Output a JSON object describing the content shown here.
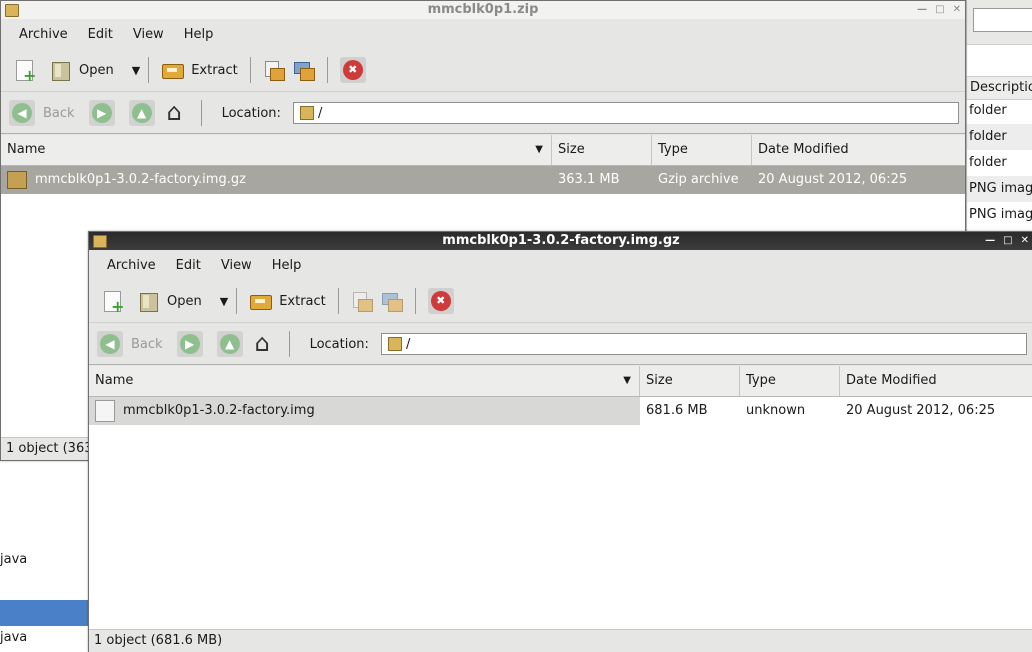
{
  "background": {
    "right_col_header": "Descriptio",
    "right_rows": [
      "folder",
      "folder",
      "folder",
      "PNG image",
      "PNG image"
    ],
    "left_rows": [
      "java",
      "java"
    ]
  },
  "win1": {
    "title": "mmcblk0p1.zip",
    "menu": [
      "Archive",
      "Edit",
      "View",
      "Help"
    ],
    "toolbar": {
      "open_label": "Open",
      "extract_label": "Extract"
    },
    "nav": {
      "back_label": "Back",
      "location_label": "Location:",
      "location_value": "/"
    },
    "columns": [
      "Name",
      "Size",
      "Type",
      "Date Modified"
    ],
    "rows": [
      {
        "name": "mmcblk0p1-3.0.2-factory.img.gz",
        "size": "363.1 MB",
        "type": "Gzip archive",
        "date": "20 August 2012, 06:25"
      }
    ],
    "status": "1 object (363"
  },
  "win2": {
    "title": "mmcblk0p1-3.0.2-factory.img.gz",
    "menu": [
      "Archive",
      "Edit",
      "View",
      "Help"
    ],
    "toolbar": {
      "open_label": "Open",
      "extract_label": "Extract"
    },
    "nav": {
      "back_label": "Back",
      "location_label": "Location:",
      "location_value": "/"
    },
    "columns": [
      "Name",
      "Size",
      "Type",
      "Date Modified"
    ],
    "rows": [
      {
        "name": "mmcblk0p1-3.0.2-factory.img",
        "size": "681.6 MB",
        "type": "unknown",
        "date": "20 August 2012, 06:25"
      }
    ],
    "status": "1 object (681.6 MB)"
  },
  "colors": {
    "selection_dark": "#a7a6a0",
    "background_selection": "#4a80c7",
    "stop_red": "#cf3a3a"
  }
}
